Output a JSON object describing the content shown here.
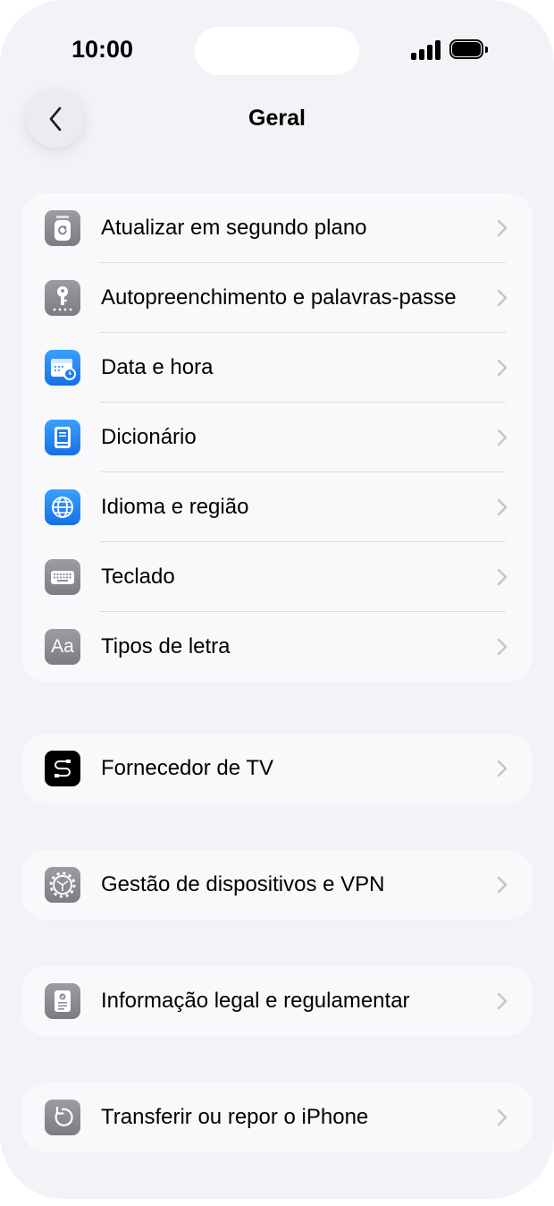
{
  "status_bar": {
    "time": "10:00"
  },
  "nav": {
    "title": "Geral",
    "back_icon": "chevron-left-icon"
  },
  "groups": [
    {
      "items": [
        {
          "label": "Atualizar em segundo plano",
          "icon": "background-refresh-icon"
        },
        {
          "label": "Autopreenchimento e palavras-passe",
          "icon": "key-icon"
        },
        {
          "label": "Data e hora",
          "icon": "calendar-clock-icon"
        },
        {
          "label": "Dicionário",
          "icon": "book-icon"
        },
        {
          "label": "Idioma e região",
          "icon": "globe-icon"
        },
        {
          "label": "Teclado",
          "icon": "keyboard-icon"
        },
        {
          "label": "Tipos de letra",
          "icon": "fonts-icon",
          "icon_text": "Aa"
        }
      ]
    },
    {
      "items": [
        {
          "label": "Fornecedor de TV",
          "icon": "tv-provider-icon"
        }
      ]
    },
    {
      "items": [
        {
          "label": "Gestão de dispositivos e VPN",
          "icon": "gear-icon"
        }
      ]
    },
    {
      "items": [
        {
          "label": "Informação legal e regulamentar",
          "icon": "legal-document-icon"
        }
      ]
    },
    {
      "items": [
        {
          "label": "Transferir ou repor o iPhone",
          "icon": "reset-icon"
        }
      ]
    }
  ],
  "colors": {
    "background": "#f2f2f7",
    "card": "#f9f9fb",
    "chevron": "#c4c4c9",
    "icon_grey": "#8e8e93",
    "icon_blue": "#1a7cf0"
  }
}
